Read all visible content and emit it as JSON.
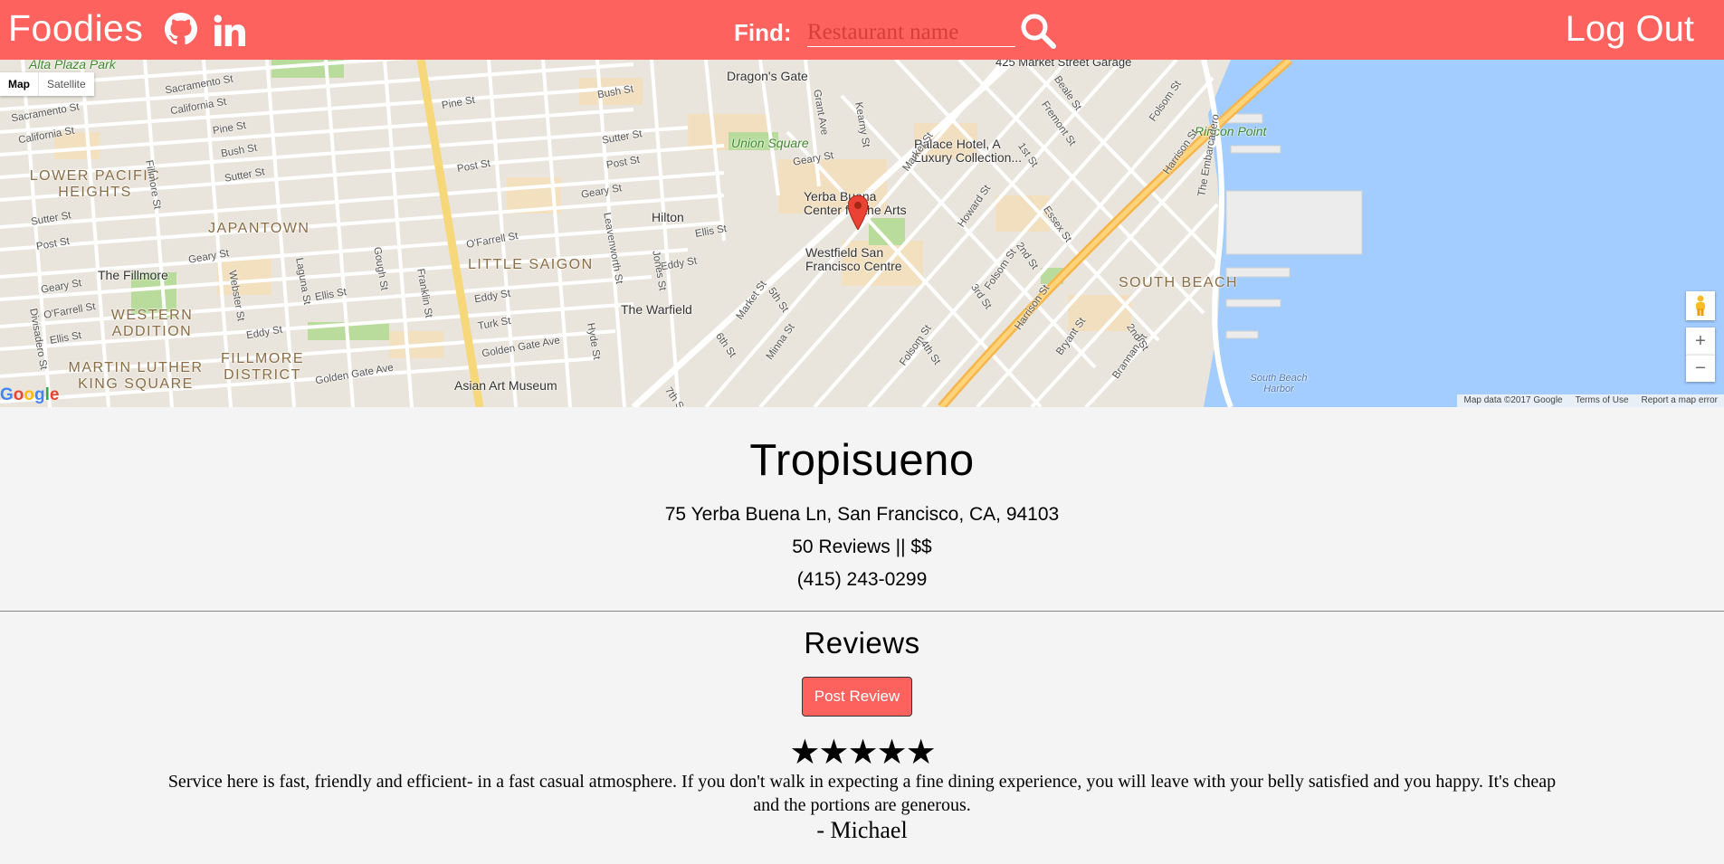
{
  "nav": {
    "brand": "Foodies",
    "find_label": "Find:",
    "search_placeholder": "Restaurant name",
    "logout_label": "Log Out",
    "bg_color": "#fd625e"
  },
  "map": {
    "type_map": "Map",
    "type_satellite": "Satellite",
    "logo": "Google",
    "attribution": {
      "data": "Map data ©2017 Google",
      "terms": "Terms of Use",
      "report": "Report a map error"
    },
    "labels": {
      "alta_plaza_park": "Alta Plaza Park",
      "lower_pacific_heights": "LOWER PACIFIC HEIGHTS",
      "japantown": "JAPANTOWN",
      "the_fillmore": "The Fillmore",
      "western_addition": "WESTERN ADDITION",
      "martin_luther_king_square": "MARTIN LUTHER KING SQUARE",
      "fillmore_district": "FILLMORE DISTRICT",
      "little_saigon": "LITTLE SAIGON",
      "asian_art_museum": "Asian Art Museum",
      "the_warfield": "The Warfield",
      "hilton": "Hilton",
      "union_square": "Union Square",
      "dragons_gate": "Dragon's Gate",
      "yerba_buena_center": "Yerba Buena Center for the Arts",
      "westfield": "Westfield San Francisco Centre",
      "palace_hotel": "Palace Hotel, A Luxury Collection...",
      "market_street_garage": "425 Market Street Garage",
      "rincon_point": "Rincon Point",
      "south_beach": "SOUTH BEACH",
      "south_beach_harbor": "South Beach Harbor",
      "the_embarcadero": "The Embarcadero"
    },
    "streets": {
      "sacramento": "Sacramento St",
      "california": "California St",
      "pine": "Pine St",
      "bush": "Bush St",
      "sutter": "Sutter St",
      "post": "Post St",
      "geary": "Geary St",
      "ofarrell": "O'Farrell St",
      "ellis": "Ellis St",
      "eddy": "Eddy St",
      "turk": "Turk St",
      "golden_gate": "Golden Gate Ave",
      "fillmore": "Fillmore St",
      "webster": "Webster St",
      "laguna": "Laguna St",
      "gough": "Gough St",
      "franklin": "Franklin St",
      "leavenworth": "Leavenworth St",
      "hyde": "Hyde St",
      "jones": "Jones St",
      "market": "Market St",
      "mission": "Mission St",
      "howard": "Howard St",
      "folsom": "Folsom St",
      "harrison": "Harrison St",
      "bryant": "Bryant St",
      "brannan": "Brannan St",
      "kearny": "Kearny St",
      "grant": "Grant Ave",
      "first": "1st St",
      "second": "2nd St",
      "third": "3rd St",
      "fourth": "4th St",
      "fifth": "5th St",
      "sixth": "6th St",
      "seventh": "7th St",
      "fremont": "Fremont St",
      "beale": "Beale St",
      "essex": "Essex St",
      "minna": "Minna St",
      "divisadero": "Divisadero St"
    }
  },
  "restaurant": {
    "name": "Tropisueno",
    "address": "75 Yerba Buena Ln, San Francisco, CA, 94103",
    "meta": "50 Reviews || $$",
    "phone": "(415) 243-0299"
  },
  "reviews": {
    "heading": "Reviews",
    "post_label": "Post Review",
    "items": [
      {
        "rating": 5,
        "stars": "★★★★★",
        "text": "Service here is fast, friendly and efficient- in a fast casual atmosphere. If you don't walk in expecting a fine dining experience, you will leave with your belly satisfied and you happy. It's cheap and the portions are generous.",
        "author": "- Michael"
      }
    ]
  }
}
